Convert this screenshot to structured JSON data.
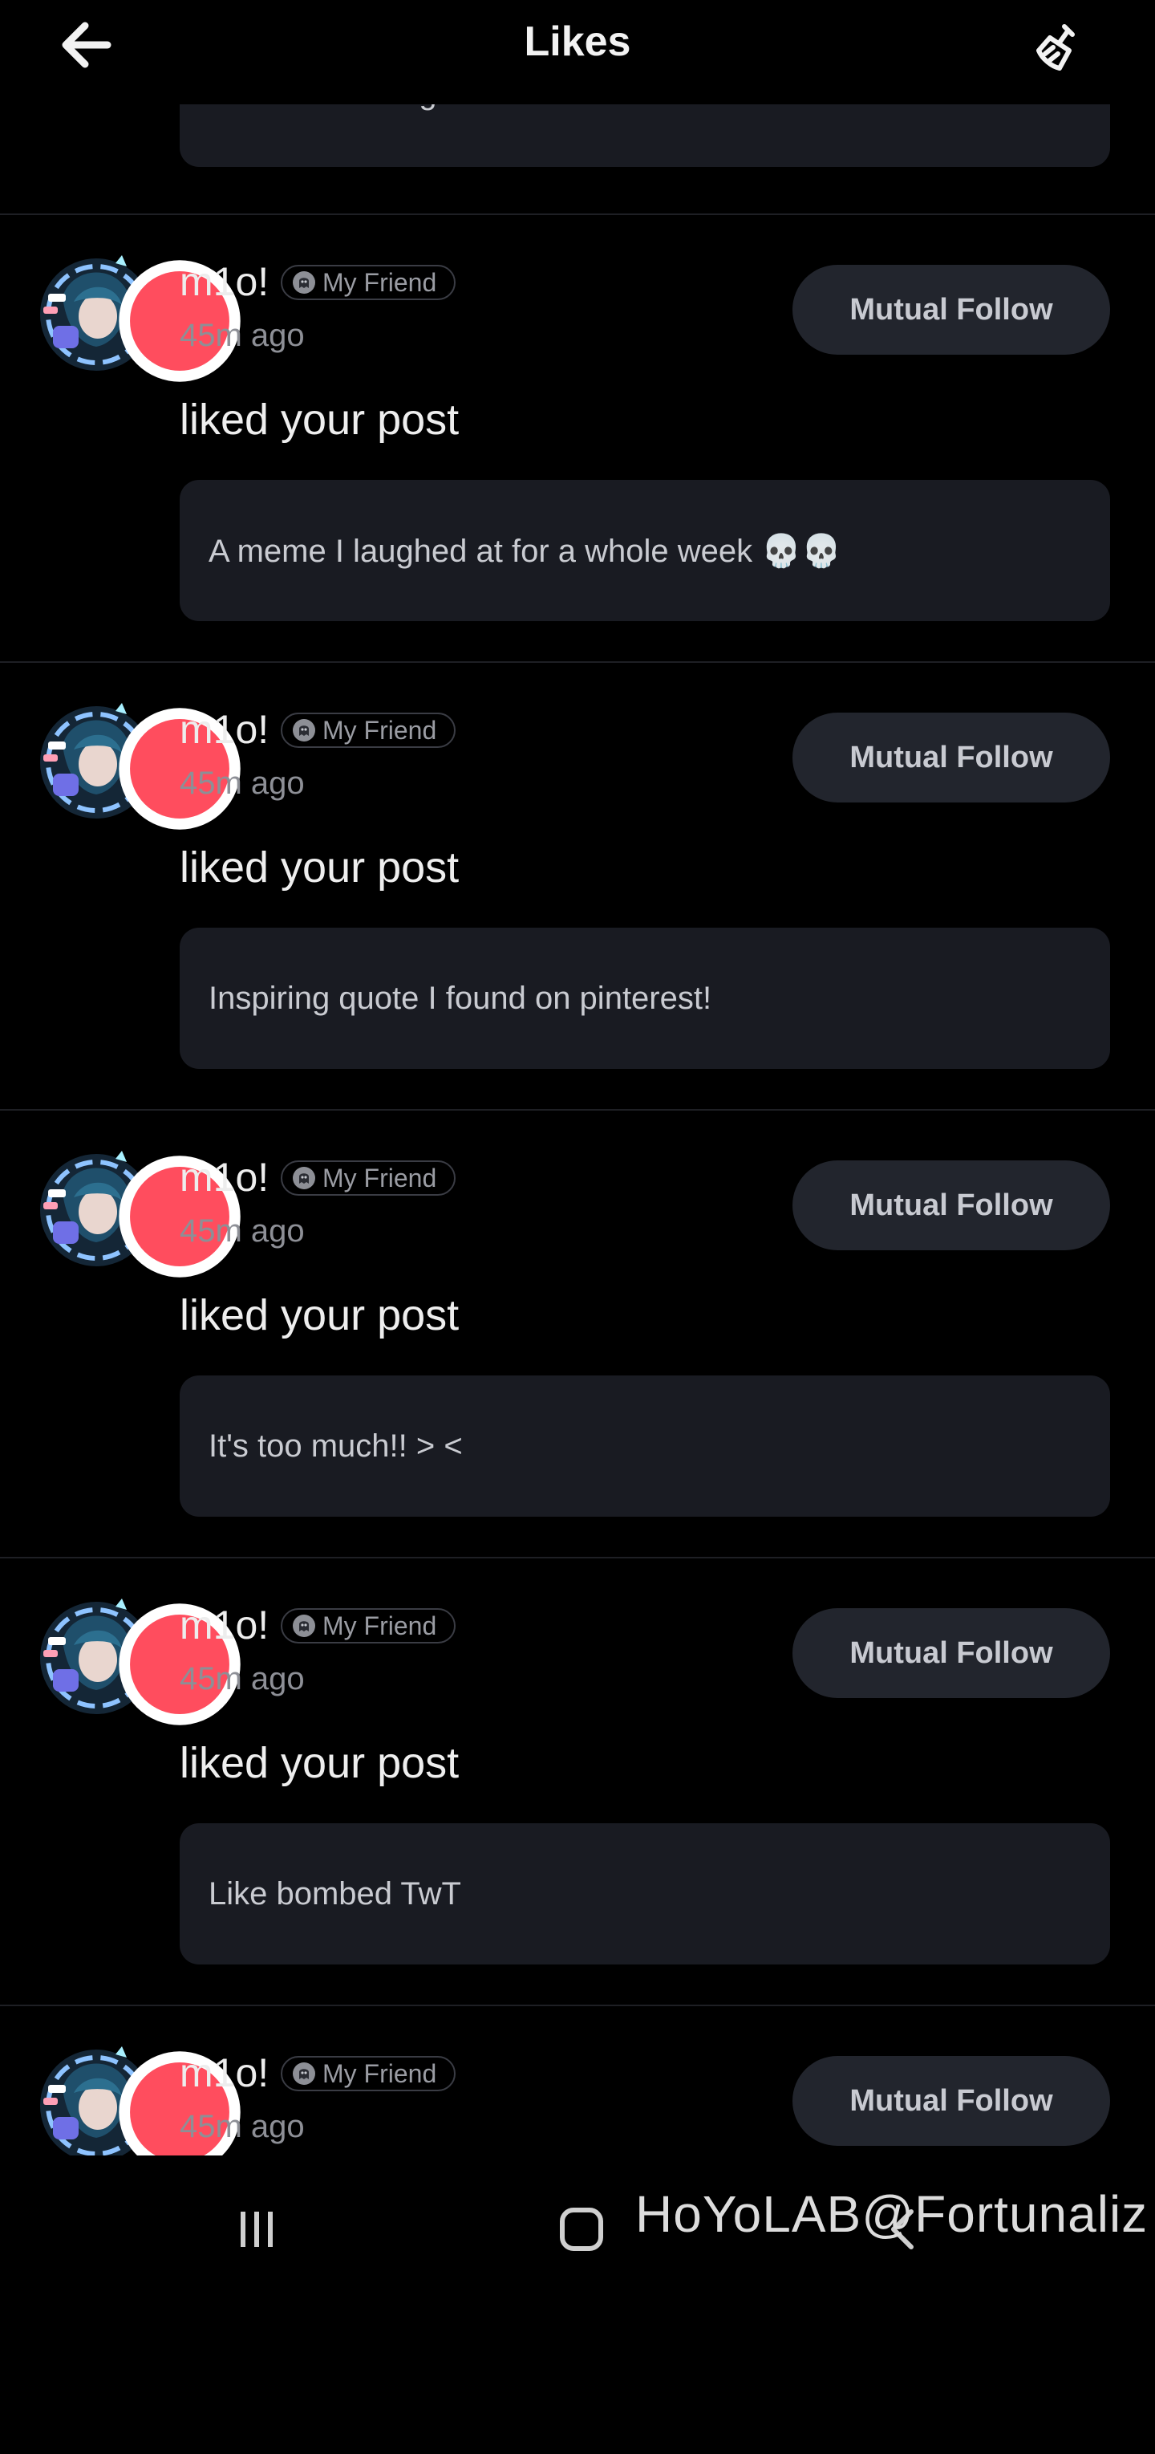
{
  "header": {
    "title": "Likes",
    "back_icon": "arrow-left-icon",
    "clear_icon": "broom-icon"
  },
  "partial_post": "Like bombed again",
  "feed": [
    {
      "username": "m1o!",
      "badge": "My Friend",
      "time": "45m ago",
      "follow_label": "Mutual Follow",
      "action": "liked your post",
      "post": "A meme I laughed at for a whole week 💀💀"
    },
    {
      "username": "m1o!",
      "badge": "My Friend",
      "time": "45m ago",
      "follow_label": "Mutual Follow",
      "action": "liked your post",
      "post": "Inspiring quote I found on pinterest!"
    },
    {
      "username": "m1o!",
      "badge": "My Friend",
      "time": "45m ago",
      "follow_label": "Mutual Follow",
      "action": "liked your post",
      "post": "It's too much!! > <"
    },
    {
      "username": "m1o!",
      "badge": "My Friend",
      "time": "45m ago",
      "follow_label": "Mutual Follow",
      "action": "liked your post",
      "post": "Like bombed TwT"
    },
    {
      "username": "m1o!",
      "badge": "My Friend",
      "time": "45m ago",
      "follow_label": "Mutual Follow",
      "action": "",
      "post": ""
    }
  ],
  "navbar": {
    "recents_icon": "recent-apps-icon",
    "home_icon": "home-icon",
    "back_icon": "nav-back-icon",
    "watermark": "HoYoLAB@Fortunaliz"
  },
  "colors": {
    "background": "#000000",
    "card": "#191b22",
    "button": "#22252d",
    "notification_dot": "#ff4d5e"
  }
}
